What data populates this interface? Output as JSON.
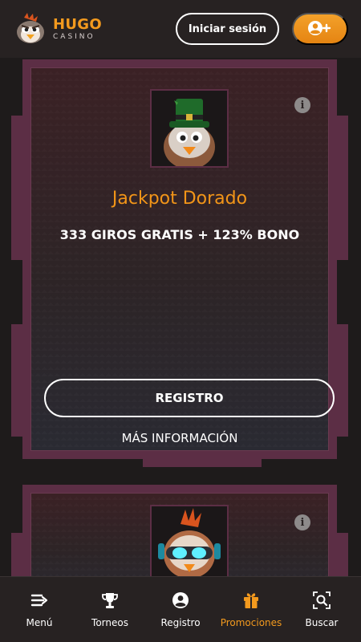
{
  "header": {
    "logo_name": "HUGO",
    "logo_sub": "CASINO",
    "login_label": "Iniciar sesión",
    "register_icon": "user-plus-icon"
  },
  "promos": [
    {
      "title": "Jackpot Dorado",
      "subtitle": "333 GIROS GRATIS + 123% BONO",
      "register_label": "REGISTRO",
      "more_label": "MÁS INFORMACIÓN",
      "image": "leprechaun-chicken-mascot",
      "info_icon": "info-icon"
    },
    {
      "image": "goggles-chicken-mascot",
      "info_icon": "info-icon"
    }
  ],
  "bottom_nav": [
    {
      "label": "Menú",
      "icon": "menu-icon",
      "active": false
    },
    {
      "label": "Torneos",
      "icon": "trophy-icon",
      "active": false
    },
    {
      "label": "Registro",
      "icon": "user-circle-icon",
      "active": false
    },
    {
      "label": "Promociones",
      "icon": "gift-icon",
      "active": true
    },
    {
      "label": "Buscar",
      "icon": "search-icon",
      "active": false
    }
  ],
  "colors": {
    "accent": "#f39a1e",
    "card_frame": "#5c2e45",
    "background": "#1e1b1b"
  }
}
